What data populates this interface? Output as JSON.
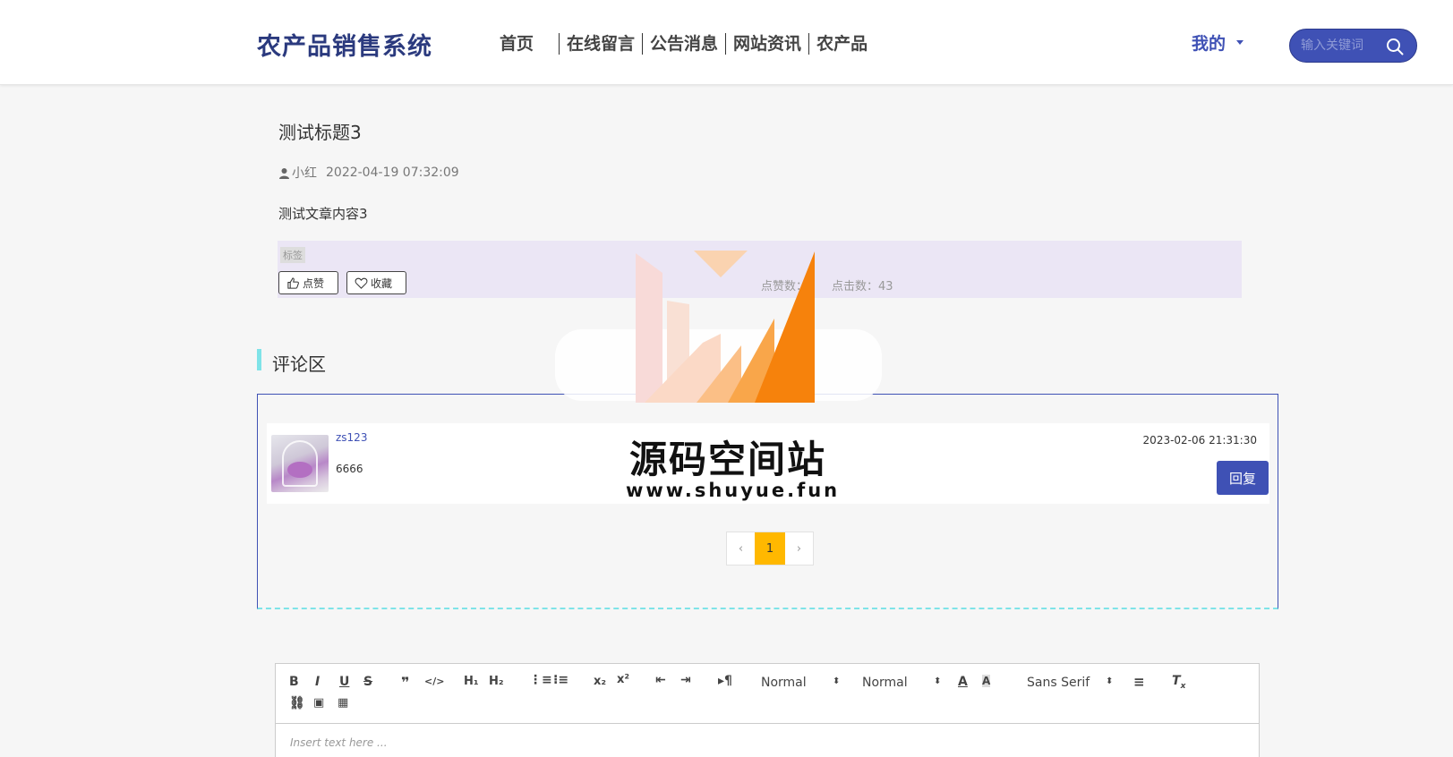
{
  "header": {
    "logo": "农产品销售系统",
    "nav": [
      "首页",
      "在线留言",
      "公告消息",
      "网站资讯",
      "农产品"
    ],
    "user_menu": "我的",
    "search_placeholder": "输入关键词"
  },
  "article": {
    "title": "测试标题3",
    "author": "小红",
    "date": "2022-04-19 07:32:09",
    "content": "测试文章内容3",
    "tag_label": "标签",
    "like_button": "点赞",
    "favorite_button": "收藏",
    "like_count_label": "点赞数：",
    "click_count_label": "点击数：",
    "click_count": "43"
  },
  "comments": {
    "section_title": "评论区",
    "items": [
      {
        "user": "zs123",
        "text": "6666",
        "date": "2023-02-06 21:31:30",
        "reply_label": "回复"
      }
    ],
    "pagination": {
      "prev": "‹",
      "current": "1",
      "next": "›"
    }
  },
  "editor": {
    "header_select": "Normal",
    "size_select": "Normal",
    "font_select": "Sans Serif",
    "placeholder": "Insert text here ..."
  },
  "watermark": {
    "title": "源码空间站",
    "url": "www.shuyue.fun"
  },
  "colors": {
    "primary": "#3f51b5",
    "accent": "#7fe3e8",
    "page_active": "#ffb800",
    "tag_bg": "#ebe6f5"
  }
}
